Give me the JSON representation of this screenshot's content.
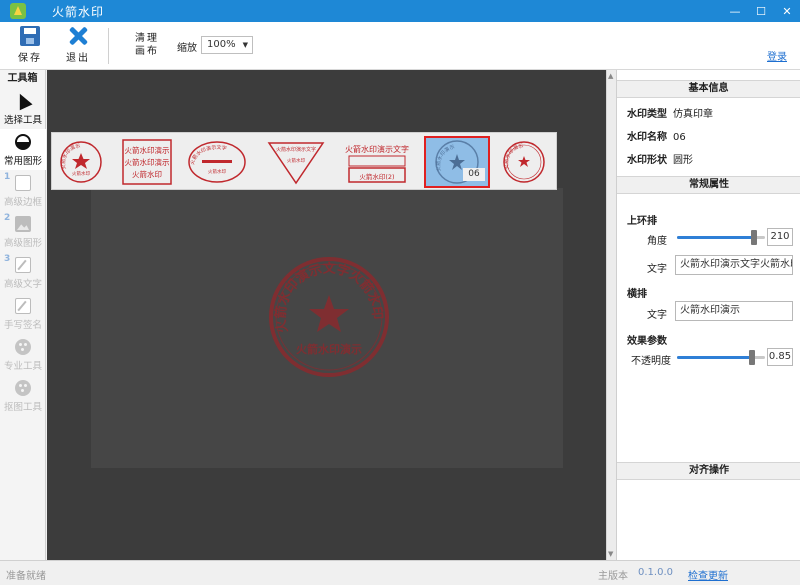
{
  "window": {
    "title": "火箭水印",
    "controls": {
      "minimize": "—",
      "maximize": "☐",
      "close": "✕"
    }
  },
  "toolbar": {
    "save_label": "保存",
    "exit_label": "退出",
    "clear_label": "清理画布",
    "zoom_label": "缩放",
    "zoom_value": "100%",
    "login_label": "登录"
  },
  "toolbox": {
    "title": "工具箱",
    "tools": [
      {
        "label": "选择工具",
        "icon": "cursor-icon"
      },
      {
        "label": "常用图形",
        "icon": "shape-icon"
      },
      {
        "label": "高级边框",
        "icon": "border-icon",
        "step": "1"
      },
      {
        "label": "高级图形",
        "icon": "image-icon",
        "step": "2"
      },
      {
        "label": "高级文字",
        "icon": "text-edit-icon",
        "step": "3"
      },
      {
        "label": "手写签名",
        "icon": "pen-icon"
      },
      {
        "label": "专业工具",
        "icon": "palette-icon"
      },
      {
        "label": "抠图工具",
        "icon": "palette-icon"
      }
    ]
  },
  "stamps": {
    "selected_badge": "06",
    "items": [
      {
        "type": "circle-star",
        "top": "火箭水印演示",
        "bottom": "火箭水印"
      },
      {
        "type": "square",
        "lines": [
          "火箭水印演示",
          "火箭水印演示",
          "火箭水印"
        ]
      },
      {
        "type": "ellipse",
        "top": "火箭水印演示文字",
        "bottom": "火箭水印"
      },
      {
        "type": "triangle",
        "top": "火箭水印演示文字",
        "bottom": "火箭水印"
      },
      {
        "type": "rect-text",
        "top": "火箭水印演示文字",
        "bottom": "火箭水印(2)"
      },
      {
        "type": "circle-selected",
        "top": "火箭水印演示"
      },
      {
        "type": "circle-small",
        "top": "火箭水印演示"
      }
    ]
  },
  "canvas_stamp": {
    "ring_text": "火箭水印演示文字火箭水印",
    "bottom_text": "火箭水印演示"
  },
  "panel": {
    "basic_info_title": "基本信息",
    "type_key": "水印类型",
    "type_value": "仿真印章",
    "name_key": "水印名称",
    "name_value": "06",
    "shape_key": "水印形状",
    "shape_value": "圆形",
    "general_title": "常规属性",
    "ring_section": "上环排",
    "angle_label": "角度",
    "angle_value": "210",
    "angle_level": 0.88,
    "ring_text_label": "文字",
    "ring_text_value": "火箭水印演示文字火箭水印",
    "horizontal_section": "横排",
    "horizontal_text_label": "文字",
    "horizontal_text_value": "火箭水印演示",
    "effect_section": "效果参数",
    "opacity_label": "不透明度",
    "opacity_value": "0.85",
    "opacity_level": 0.85,
    "align_title": "对齐操作"
  },
  "status": {
    "text": "准备就绪",
    "version_label": "主版本",
    "version_value": "0.1.0.0",
    "update_label": "检查更新"
  },
  "colors": {
    "titlebar": "#1e88d6",
    "stamp_red": "#c0282d",
    "selected_bg": "#8fbde6",
    "accent": "#2f7fd6"
  }
}
